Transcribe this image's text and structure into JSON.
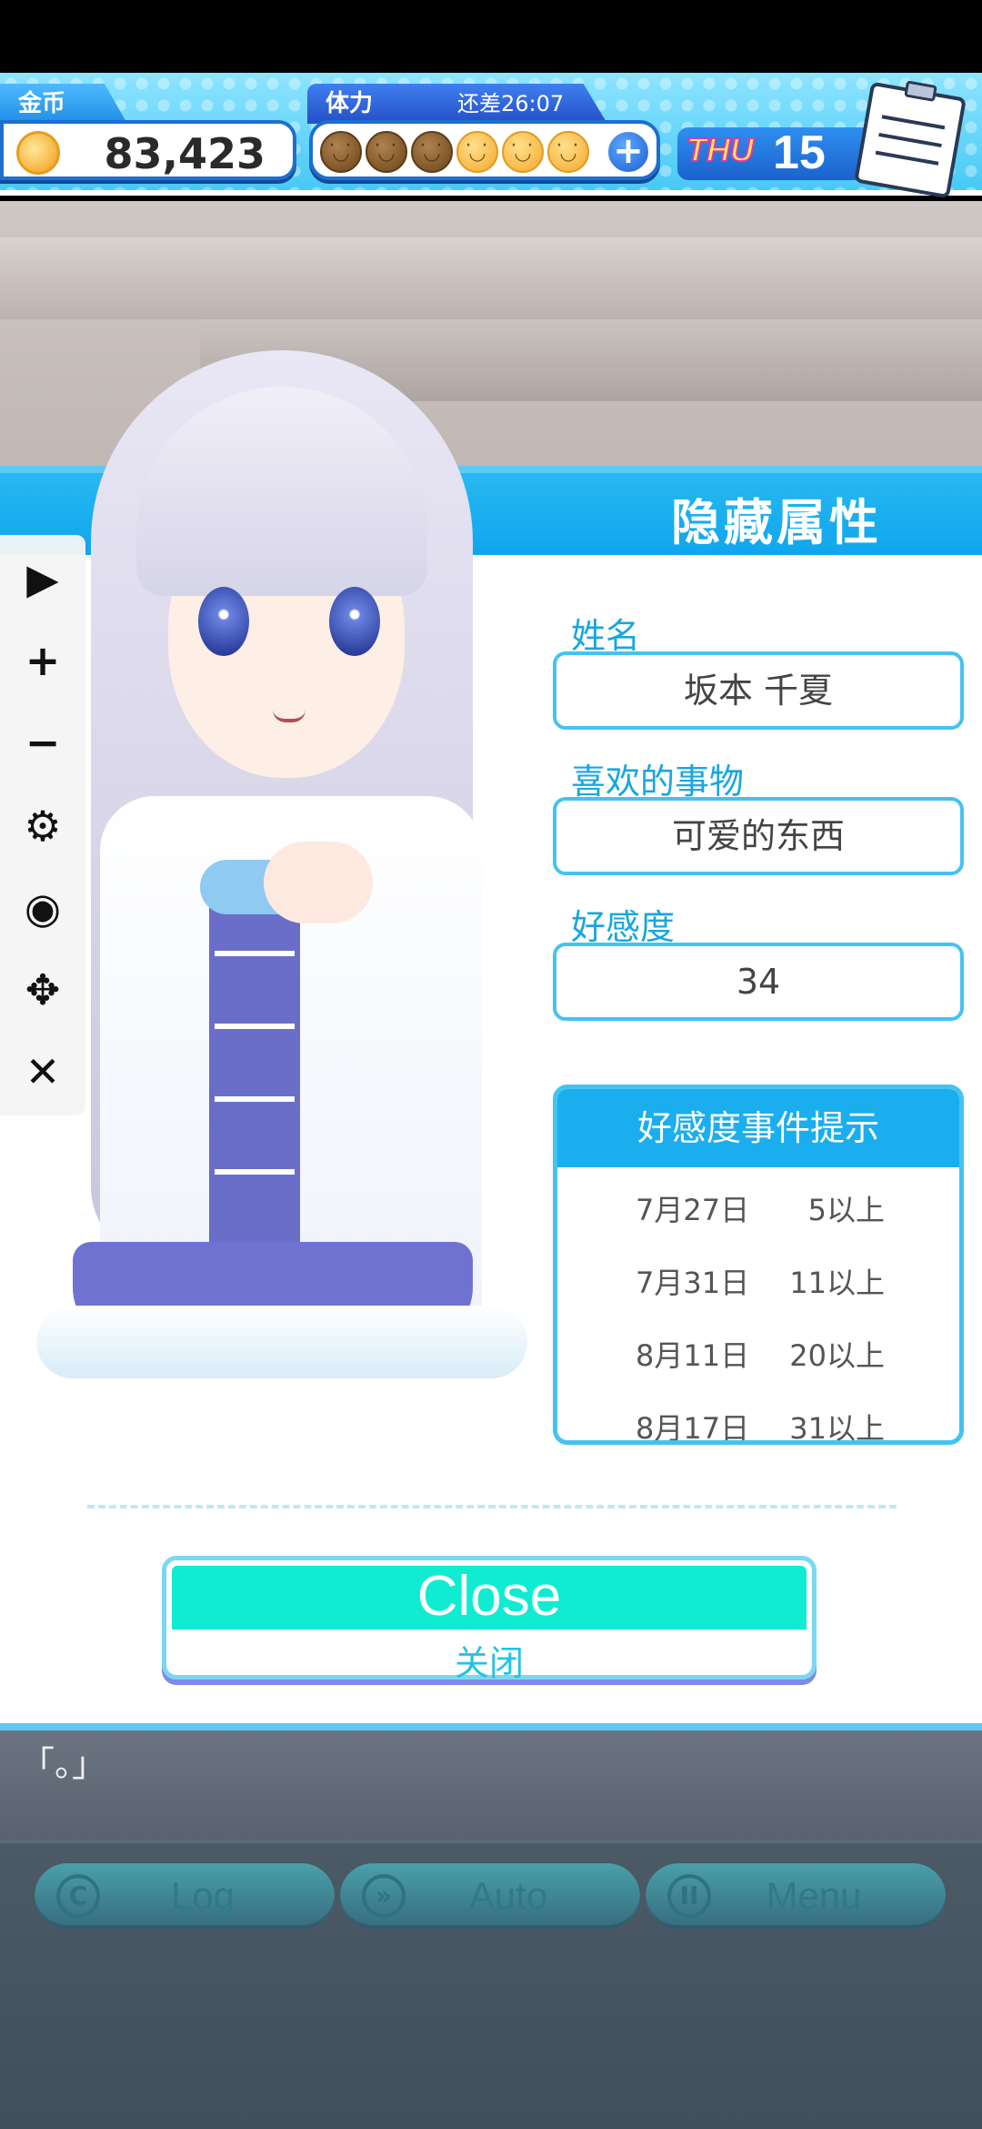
{
  "hud": {
    "coins_label": "金币",
    "coins_value": "83,423",
    "stamina_label": "体力",
    "stamina_timer": "还差26:07",
    "stamina_spent": 3,
    "stamina_total": 6,
    "weekday": "THU",
    "day": "15"
  },
  "panel": {
    "title": "隐藏属性",
    "fields": [
      {
        "label": "姓名",
        "value": "坂本 千夏"
      },
      {
        "label": "喜欢的事物",
        "value": "可爱的东西"
      },
      {
        "label": "好感度",
        "value": "34"
      }
    ],
    "events_title": "好感度事件提示",
    "events": [
      {
        "date": "7月27日",
        "req": "5以上"
      },
      {
        "date": "7月31日",
        "req": "11以上"
      },
      {
        "date": "8月11日",
        "req": "20以上"
      },
      {
        "date": "8月17日",
        "req": "31以上"
      }
    ],
    "close_label_en": "Close",
    "close_label_zh": "关闭"
  },
  "toolbar": {
    "icons": [
      "play-icon",
      "plus-icon",
      "minus-icon",
      "gear-icon",
      "eye-icon",
      "move-icon",
      "close-icon"
    ]
  },
  "dialog": {
    "text": "「。」"
  },
  "bottom_bar": {
    "log_label": "Log",
    "auto_label": "Auto",
    "menu_label": "Menu"
  },
  "colors": {
    "accent": "#1aaeee",
    "close_fill": "#10ecd2",
    "panel_border": "#46c2f0"
  }
}
